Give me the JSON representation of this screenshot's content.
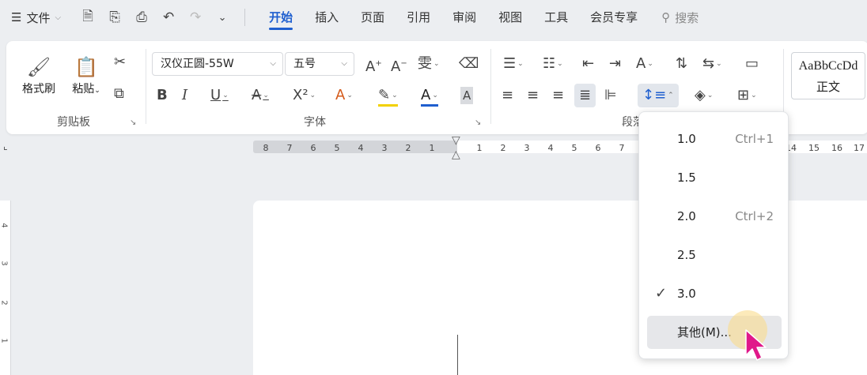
{
  "menubar": {
    "file_label": "文件",
    "tabs": [
      "开始",
      "插入",
      "页面",
      "引用",
      "审阅",
      "视图",
      "工具",
      "会员专享"
    ],
    "active_tab": "开始",
    "search_label": "搜索"
  },
  "ribbon": {
    "clipboard": {
      "format_painter": "格式刷",
      "paste": "粘贴",
      "group_label": "剪贴板"
    },
    "font": {
      "font_name": "汉仪正圆-55W",
      "font_size": "五号",
      "group_label": "字体"
    },
    "paragraph": {
      "group_label": "段落"
    },
    "styles": {
      "sample": "AaBbCcDd",
      "name": "正文"
    }
  },
  "ruler": {
    "left_marks": [
      "8",
      "7",
      "6",
      "5",
      "4",
      "3",
      "2",
      "1"
    ],
    "right_marks": [
      "1",
      "2",
      "3",
      "4",
      "5",
      "6",
      "7"
    ],
    "far_right_marks": [
      "14",
      "15",
      "16",
      "17"
    ],
    "vertical_marks": [
      "4",
      "3",
      "2",
      "1"
    ]
  },
  "line_spacing_menu": {
    "items": [
      {
        "value": "1.0",
        "shortcut": "Ctrl+1",
        "checked": false
      },
      {
        "value": "1.5",
        "shortcut": "",
        "checked": false
      },
      {
        "value": "2.0",
        "shortcut": "Ctrl+2",
        "checked": false
      },
      {
        "value": "2.5",
        "shortcut": "",
        "checked": false
      },
      {
        "value": "3.0",
        "shortcut": "",
        "checked": true
      }
    ],
    "more_label": "其他(M)..."
  },
  "colors": {
    "accent": "#1f5fcf",
    "highlight": "#f2d100",
    "font_color": "#1f5fcf",
    "cursor": "#e0188a"
  }
}
